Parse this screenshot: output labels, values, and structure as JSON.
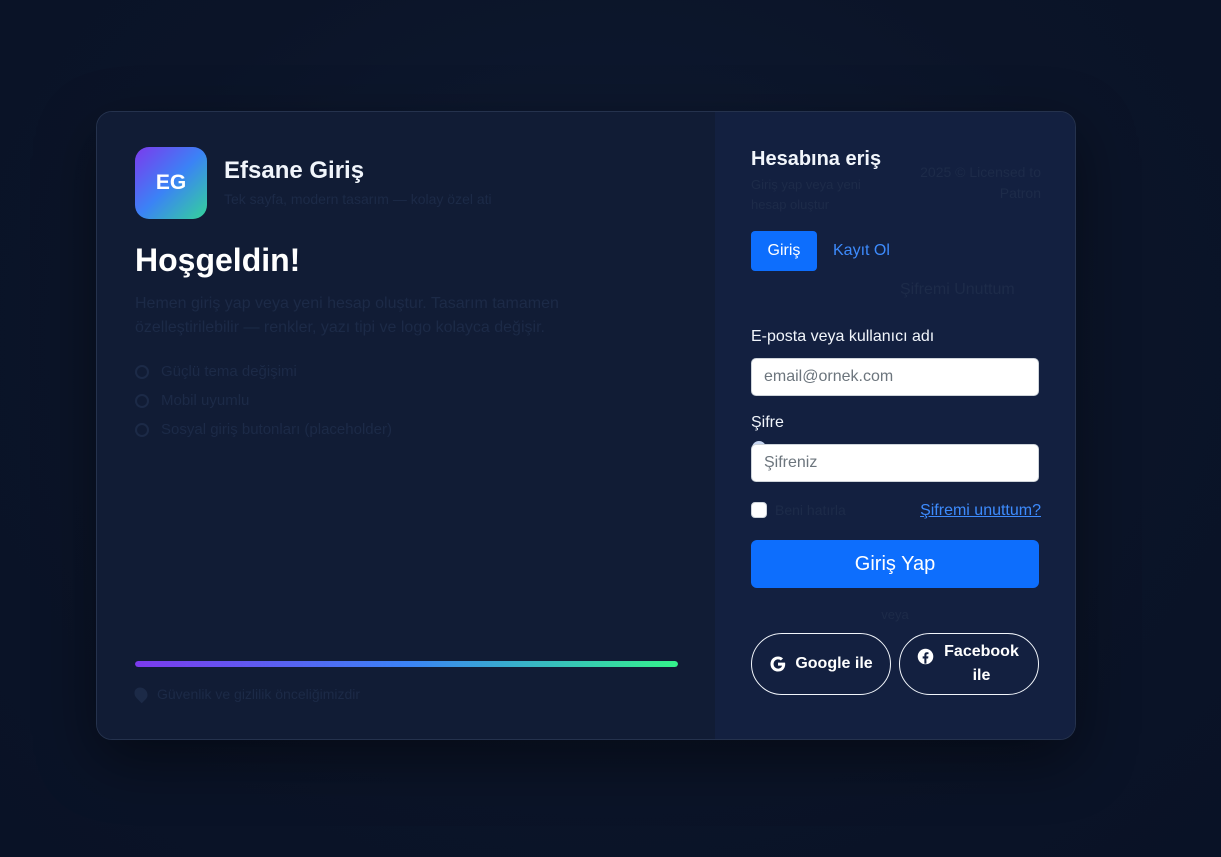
{
  "brand": {
    "logo_text": "EG",
    "title": "Efsane Giriş",
    "subtitle": "Tek sayfa, modern tasarım — kolay özel ati"
  },
  "welcome": {
    "heading": "Hoşgeldin!",
    "lead": "Hemen giriş yap veya yeni hesap oluştur. Tasarım tamamen özelleştirilebilir — renkler, yazı tipi ve logo kolayca değişir.",
    "features": [
      "Güçlü tema değişimi",
      "Mobil uyumlu",
      "Sosyal giriş butonları (placeholder)"
    ]
  },
  "progress": {
    "value": 1.0,
    "colors": [
      "#7c3aed",
      "#3b82f6",
      "#34f38b"
    ]
  },
  "footer_note": "Güvenlik ve gizlilik önceliğimizdir",
  "panel": {
    "title": "Hesabına eriş",
    "subtitle": "Giriş yap veya yeni hesap oluştur",
    "license": "2025 © Licensed to Patron",
    "tab_login": "Giriş",
    "tab_register": "Kayıt Ol",
    "forgot_top": "Şifremi Unuttum"
  },
  "form": {
    "email_label": "E-posta veya kullanıcı adı",
    "email_placeholder": "email@ornek.com",
    "password_label": "Şifre",
    "password_placeholder": "Şifreniz",
    "remember_label": "Beni hatırla",
    "forgot_link": "Şifremi unuttum?",
    "submit_label": "Giriş Yap",
    "or_text": "veya"
  },
  "social": {
    "google_label": "Google ile",
    "facebook_label": "Facebook ile"
  },
  "colors": {
    "accent": "#0d6efd",
    "link": "#3d8bfd",
    "background": "#0b1428",
    "card": "#111d36"
  }
}
